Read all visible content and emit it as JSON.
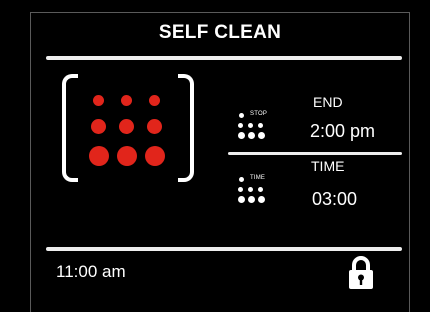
{
  "title": "SELF CLEAN",
  "end": {
    "indicator": "STOP",
    "label": "END",
    "value": "2:00 pm"
  },
  "duration": {
    "indicator": "TIME",
    "label": "TIME",
    "value": "03:00"
  },
  "clock": "11:00 am",
  "icons": {
    "cavity": "oven-cavity-icon",
    "lock": "lock-icon"
  },
  "colors": {
    "background": "#000000",
    "accent": "#e1251b",
    "text": "#ffffff"
  }
}
